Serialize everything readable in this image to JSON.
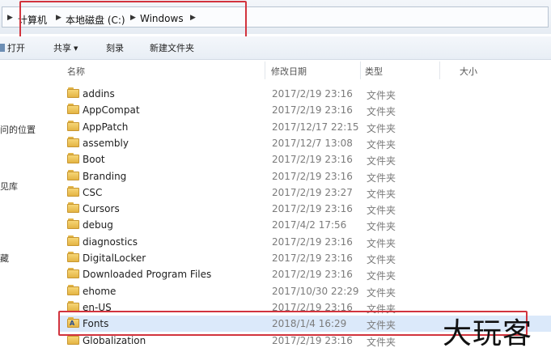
{
  "address": {
    "crumbs": [
      "计算机",
      "本地磁盘 (C:)",
      "Windows"
    ]
  },
  "toolbar": {
    "open_label": "打开",
    "share_label": "共享",
    "burn_label": "刻录",
    "new_folder_label": "新建文件夹"
  },
  "nav": {
    "items": [
      "问的位置",
      "见库",
      "藏"
    ]
  },
  "columns": {
    "name": "名称",
    "date": "修改日期",
    "type": "类型",
    "size": "大小"
  },
  "files": [
    {
      "name": "addins",
      "date": "2017/2/19 23:16",
      "type": "文件夹"
    },
    {
      "name": "AppCompat",
      "date": "2017/2/19 23:16",
      "type": "文件夹"
    },
    {
      "name": "AppPatch",
      "date": "2017/12/17 22:15",
      "type": "文件夹"
    },
    {
      "name": "assembly",
      "date": "2017/12/7 13:08",
      "type": "文件夹"
    },
    {
      "name": "Boot",
      "date": "2017/2/19 23:16",
      "type": "文件夹"
    },
    {
      "name": "Branding",
      "date": "2017/2/19 23:16",
      "type": "文件夹"
    },
    {
      "name": "CSC",
      "date": "2017/2/19 23:27",
      "type": "文件夹"
    },
    {
      "name": "Cursors",
      "date": "2017/2/19 23:16",
      "type": "文件夹"
    },
    {
      "name": "debug",
      "date": "2017/4/2 17:56",
      "type": "文件夹"
    },
    {
      "name": "diagnostics",
      "date": "2017/2/19 23:16",
      "type": "文件夹"
    },
    {
      "name": "DigitalLocker",
      "date": "2017/2/19 23:16",
      "type": "文件夹"
    },
    {
      "name": "Downloaded Program Files",
      "date": "2017/2/19 23:16",
      "type": "文件夹"
    },
    {
      "name": "ehome",
      "date": "2017/10/30 22:29",
      "type": "文件夹"
    },
    {
      "name": "en-US",
      "date": "2017/2/19 23:16",
      "type": "文件夹"
    },
    {
      "name": "Fonts",
      "date": "2018/1/4 16:29",
      "type": "文件夹"
    },
    {
      "name": "Globalization",
      "date": "2017/2/19 23:16",
      "type": "文件夹"
    }
  ],
  "watermark": "大玩客",
  "colors": {
    "highlight": "#d2343e",
    "selection": "#dbe9fa",
    "folder": "#f6d676"
  }
}
